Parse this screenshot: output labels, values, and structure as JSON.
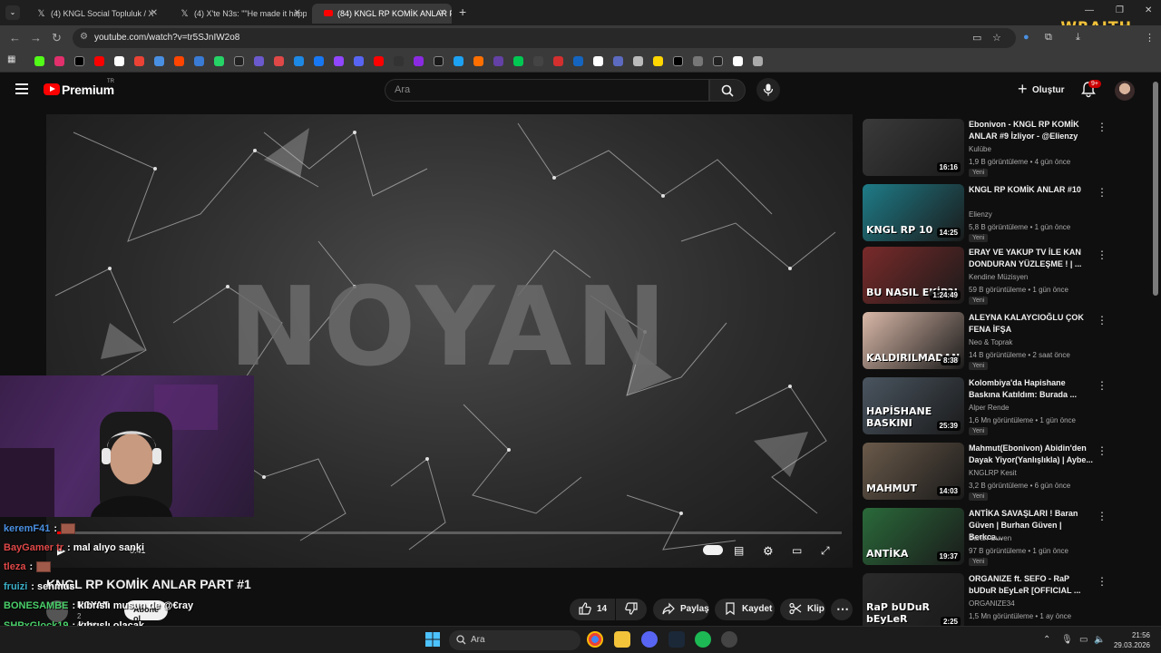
{
  "browser": {
    "tabs": [
      {
        "label": "(4) KNGL Social Topluluk / X",
        "icon": "x-logo-icon"
      },
      {
        "label": "(4) X'te N3s: \"\"He made it happ",
        "icon": "x-logo-icon"
      },
      {
        "label": "(84) KNGL RP KOMİK ANLAR P",
        "icon": "youtube-icon"
      }
    ],
    "url": "youtube.com/watch?v=tr5SJnIW2o8",
    "overlay_brand": "WRAITH"
  },
  "youtube": {
    "logo_text": "Premium",
    "logo_tr": "TR",
    "search_placeholder": "Ara",
    "create_label": "Oluştur",
    "notif_badge": "9+"
  },
  "player": {
    "overlay_text": "NOYAN",
    "time": "0:41",
    "progress": 0.01
  },
  "video": {
    "title": "KNGL RP KOMİK ANLAR PART #1",
    "channel": "NOYAN",
    "subscribers": "2 abone",
    "subscribe_label": "Abone ol",
    "likes": "14",
    "share_label": "Paylaş",
    "save_label": "Kaydet",
    "clip_label": "Klip"
  },
  "recommendations": [
    {
      "title": "Ebonivon - KNGL RP KOMİK ANLAR #9 İzliyor - @Elienzy",
      "channel": "Kulübe",
      "views": "1,9 B görüntüleme",
      "age": "4 gün önce",
      "badge": "Yeni",
      "duration": "16:16",
      "caption": "",
      "color": "#3a3a3a"
    },
    {
      "title": "KNGL RP KOMİK ANLAR #10",
      "channel": "Elienzy",
      "views": "5,8 B görüntüleme",
      "age": "1 gün önce",
      "badge": "Yeni",
      "duration": "14:25",
      "caption": "KNGL RP 10",
      "color": "#1e7c88"
    },
    {
      "title": "ERAY VE YAKUP TV İLE KAN DONDURAN YÜZLEŞME ! | ...",
      "channel": "Kendine Müzisyen",
      "views": "59 B görüntüleme",
      "age": "1 gün önce",
      "badge": "Yeni",
      "duration": "1:24:49",
      "caption": "BU NASIL EKİP?!",
      "color": "#7a2a2a"
    },
    {
      "title": "ALEYNA KALAYCIOĞLU ÇOK FENA İFŞA",
      "channel": "Neo & Toprak",
      "views": "14 B görüntüleme",
      "age": "2 saat önce",
      "badge": "Yeni",
      "duration": "8:38",
      "caption": "KALDIRILMADAN",
      "color": "#d9b8a8"
    },
    {
      "title": "Kolombiya'da Hapishane Baskına Katıldım: Burada ...",
      "channel": "Alper Rende",
      "views": "1,6 Mn görüntüleme",
      "age": "1 gün önce",
      "badge": "Yeni",
      "duration": "25:39",
      "caption": "HAPİSHANE BASKINI",
      "color": "#4a5560"
    },
    {
      "title": "Mahmut(Ebonivon) Abidin'den Dayak Yiyor(Yanlışlıkla) | Aybe...",
      "channel": "KNGLRP Kesit",
      "views": "3,2 B görüntüleme",
      "age": "6 gün önce",
      "badge": "Yeni",
      "duration": "14:03",
      "caption": "MAHMUT",
      "color": "#6a5a4a"
    },
    {
      "title": "ANTİKA SAVAŞLARI ! Baran Güven | Burhan Güven | Berkca...",
      "channel": "Baran Guven",
      "views": "97 B görüntüleme",
      "age": "1 gün önce",
      "badge": "Yeni",
      "duration": "19:37",
      "caption": "ANTİKA",
      "color": "#2a6a3a"
    },
    {
      "title": "ORGANIZE ft. SEFO - RaP bUDuR bEyLeR [OFFICIAL ...",
      "channel": "ORGANIZE34",
      "views": "1,5 Mn görüntüleme",
      "age": "1 ay önce",
      "badge": "",
      "duration": "2:25",
      "caption": "RaP bUDuR bEyLeR",
      "color": "#2a2a2a"
    }
  ],
  "chat": [
    {
      "user": "keremF41",
      "color": "#4a90e2",
      "msg": ":"
    },
    {
      "user": "BayGamer tr",
      "color": "#e04848",
      "msg": ": mal alıyo sanki"
    },
    {
      "user": "tleza",
      "color": "#e04848",
      "msg": ":"
    },
    {
      "user": "fruizi",
      "color": "#3ab0c8",
      "msg": ": sehmus"
    },
    {
      "user": "BONESAMBE",
      "color": "#4ad06a",
      "msg": ": kıbrıslı musun de @€ray"
    },
    {
      "user": "SHPxGlock19",
      "color": "#4ad06a",
      "msg": ": kıbrıslı olacak"
    },
    {
      "user": "BaronSehmusUlas",
      "color": "#4ad06a",
      "msg": ": +kıbrıslı olması"
    }
  ],
  "taskbar": {
    "search_placeholder": "Ara",
    "time": "21:56",
    "date": "29.03.2026"
  }
}
